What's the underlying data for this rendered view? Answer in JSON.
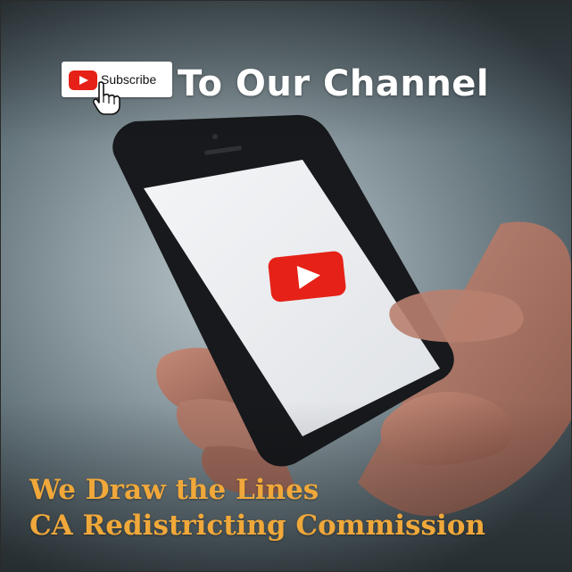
{
  "subscribe_button": {
    "label": "Subscribe",
    "icon": "youtube-logo-icon",
    "cursor_icon": "hand-pointer-icon",
    "color": "#e62117"
  },
  "headline": "To Our Channel",
  "phone_screen": {
    "icon": "youtube-play-icon",
    "color": "#e62117"
  },
  "footer": {
    "line1": "We Draw the Lines",
    "line2": "CA Redistricting Commission",
    "color": "#f0a83a"
  }
}
